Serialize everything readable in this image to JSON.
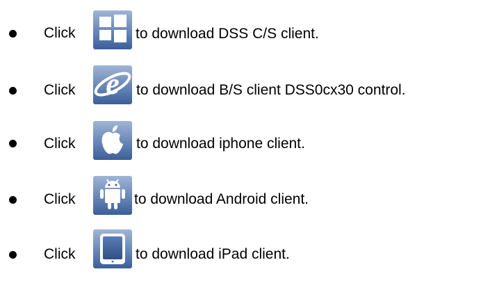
{
  "items": [
    {
      "click": "Click",
      "icon": "windows-icon",
      "text": "to download DSS C/S client."
    },
    {
      "click": "Click",
      "icon": "internet-explorer-icon",
      "text": "to download B/S client DSS0cx30 control."
    },
    {
      "click": "Click",
      "icon": "apple-icon",
      "text": "to download iphone client."
    },
    {
      "click": "Click",
      "icon": "android-icon",
      "text": "to download Android client."
    },
    {
      "click": "Click",
      "icon": "ipad-icon",
      "text": "to download iPad client."
    }
  ],
  "colors": {
    "icon_gradient_top": "#9fb5d6",
    "icon_gradient_bottom": "#3b5f9a",
    "icon_glyph": "#ffffff"
  }
}
